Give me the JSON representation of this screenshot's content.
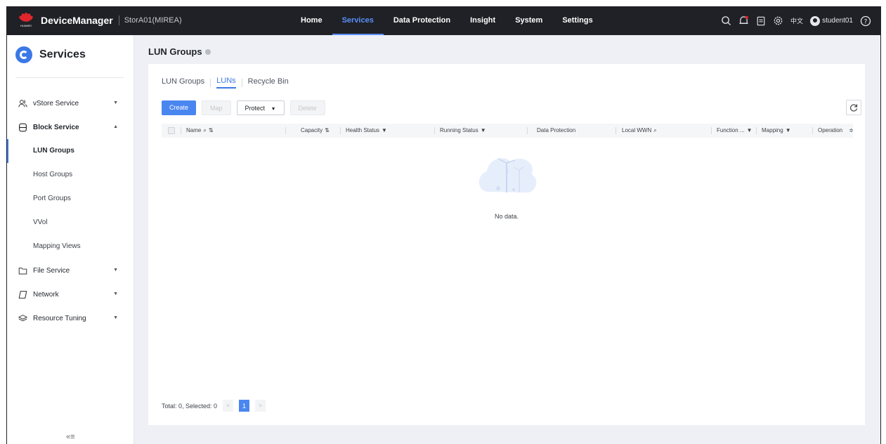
{
  "header": {
    "brand_logo_text": "HUAWEI",
    "app_name": "DeviceManager",
    "device_name": "StorA01(MIREA)",
    "nav": [
      {
        "label": "Home",
        "active": false
      },
      {
        "label": "Services",
        "active": true
      },
      {
        "label": "Data Protection",
        "active": false
      },
      {
        "label": "Insight",
        "active": false
      },
      {
        "label": "System",
        "active": false
      },
      {
        "label": "Settings",
        "active": false
      }
    ],
    "tools": [
      "search-icon",
      "alarm-bell-icon",
      "task-list-icon",
      "settings-gear-icon"
    ],
    "language": "中文",
    "username": "student01",
    "help_icon": "help-icon"
  },
  "sidebar": {
    "title": "Services",
    "groups": [
      {
        "label": "vStore Service",
        "icon": "users-icon",
        "expanded": false,
        "bold": false
      },
      {
        "label": "Block Service",
        "icon": "database-icon",
        "expanded": true,
        "bold": true,
        "items": [
          {
            "label": "LUN Groups",
            "active": true
          },
          {
            "label": "Host Groups",
            "active": false
          },
          {
            "label": "Port Groups",
            "active": false
          },
          {
            "label": "VVol",
            "active": false
          },
          {
            "label": "Mapping Views",
            "active": false
          }
        ]
      },
      {
        "label": "File Service",
        "icon": "folder-icon",
        "expanded": false,
        "bold": false
      },
      {
        "label": "Network",
        "icon": "network-icon",
        "expanded": false,
        "bold": false
      },
      {
        "label": "Resource Tuning",
        "icon": "layers-icon",
        "expanded": false,
        "bold": false
      }
    ],
    "collapse_icon": "collapse-sidebar-icon"
  },
  "page": {
    "title": "LUN Groups",
    "tabs": [
      {
        "label": "LUN Groups",
        "active": false
      },
      {
        "label": "LUNs",
        "active": true
      },
      {
        "label": "Recycle Bin",
        "active": false
      }
    ],
    "toolbar": {
      "create": "Create",
      "map": "Map",
      "protect": "Protect",
      "delete": "Delete"
    },
    "columns": [
      "Name",
      "Capacity",
      "Health Status",
      "Running Status",
      "Data Protection",
      "Local WWN",
      "Function ...",
      "Mapping",
      "Operation"
    ],
    "empty_text": "No data.",
    "pagination": {
      "summary": "Total: 0, Selected: 0",
      "current_page": "1",
      "prev": "<",
      "next": ">"
    }
  }
}
